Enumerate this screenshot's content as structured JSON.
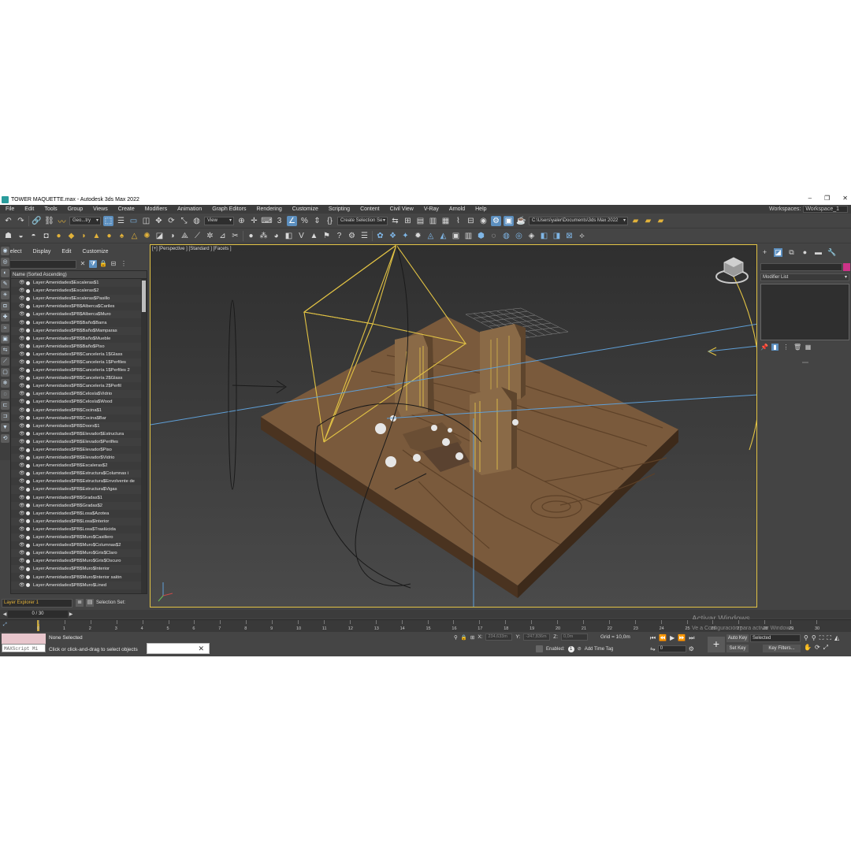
{
  "window": {
    "title": "TOWER MAQUETTE.max - Autodesk 3ds Max 2022",
    "controls": [
      "–",
      "❐",
      "✕"
    ]
  },
  "menu": {
    "items": [
      "File",
      "Edit",
      "Tools",
      "Group",
      "Views",
      "Create",
      "Modifiers",
      "Animation",
      "Graph Editors",
      "Rendering",
      "Customize",
      "Scripting",
      "Content",
      "Civil View",
      "V-Ray",
      "Arnold",
      "Help"
    ],
    "workspaces_label": "Workspaces:",
    "workspace_value": "Workspace_1"
  },
  "main_toolbar": {
    "geometry_filter": "Geo...try",
    "ref_coord": "View",
    "named_selection": "Create Selection Se",
    "project_path": "C:\\Users\\yaler\\Documents\\3ds Max 2022"
  },
  "scene_explorer": {
    "menu": [
      "Select",
      "Display",
      "Edit",
      "Customize"
    ],
    "column_header": "Name (Sorted Ascending)",
    "rows": [
      "Layer:Amenidades$Escaleras$1",
      "Layer:Amenidades$Escaleras$2",
      "Layer:Amenidades$Escaleras$Pasillo",
      "Layer:Amenidades$PB$Alberca$Cariles",
      "Layer:Amenidades$PB$Alberca$Muro",
      "Layer:Amenidades$PB$Baño$Barra",
      "Layer:Amenidades$PB$Baño$Mamparas",
      "Layer:Amenidades$PB$Baño$Mueble",
      "Layer:Amenidades$PB$Baño$Piso",
      "Layer:Amenidades$PB$Cancelería 1$Glass",
      "Layer:Amenidades$PB$Cancelería 1$Perfiles",
      "Layer:Amenidades$PB$Cancelería 1$Perfiles 2",
      "Layer:Amenidades$PB$Cancelería 2$Glass",
      "Layer:Amenidades$PB$Cancelería 2$Perfil",
      "Layer:Amenidades$PB$Celosía$Vidrio",
      "Layer:Amenidades$PB$Celosía$Wood",
      "Layer:Amenidades$PB$Cocina$1",
      "Layer:Amenidades$PB$Cocina$Bar",
      "Layer:Amenidades$PB$Doors$1",
      "Layer:Amenidades$PB$Elevador$Estructura",
      "Layer:Amenidades$PB$Elevador$Perilfes",
      "Layer:Amenidades$PB$Elevador$Piso",
      "Layer:Amenidades$PB$Elevador$Vidrio",
      "Layer:Amenidades$PB$Escaleras$2",
      "Layer:Amenidades$PB$Estructura$Columnas i",
      "Layer:Amenidades$PB$Estructura$Envolvente de",
      "Layer:Amenidades$PB$Estructura$Vigas",
      "Layer:Amenidades$PB$Gradas$1",
      "Layer:Amenidades$PB$Gradas$2",
      "Layer:Amenidades$PB$Losa$Azotea",
      "Layer:Amenidades$PB$Losa$Interior",
      "Layer:Amenidades$PB$Losa$Traslúcida",
      "Layer:Amenidades$PB$Muro$Casillero",
      "Layer:Amenidades$PB$Muro$Columnas$2",
      "Layer:Amenidades$PB$Muro$Gris$Claro",
      "Layer:Amenidades$PB$Muro$Gris$Oscuro",
      "Layer:Amenidades$PB$Muro$Interior",
      "Layer:Amenidades$PB$Muro$Interior salón",
      "Layer:Amenidades$PB$Muro$Lined"
    ],
    "bottom_explorer": "Layer Explorer 1",
    "selection_set_label": "Selection Set:"
  },
  "viewport": {
    "label": "[+] [Perspective ] [Standard ] [Facets ]"
  },
  "command_panel": {
    "modifier_list": "Modifier List",
    "object_color": "#cc3388"
  },
  "timeline": {
    "frame_display": "0 / 30",
    "ticks": [
      "0",
      "1",
      "2",
      "3",
      "4",
      "5",
      "6",
      "7",
      "8",
      "9",
      "10",
      "11",
      "12",
      "13",
      "14",
      "15",
      "16",
      "17",
      "18",
      "19",
      "20",
      "21",
      "22",
      "23",
      "24",
      "25",
      "26",
      "27",
      "28",
      "29",
      "30"
    ]
  },
  "status": {
    "maxscript": "MAXScript Mi",
    "selection": "None Selected",
    "prompt": "Click or click-and-drag to select objects",
    "x_label": "X:",
    "x_value": "234,633m",
    "y_label": "Y:",
    "y_value": "-247,836m",
    "z_label": "Z:",
    "z_value": "0,0m",
    "grid": "Grid = 10,0m",
    "enabled_label": "Enabled:",
    "add_time_tag": "Add Time Tag",
    "frame_field": "0",
    "auto_key": "Auto Key",
    "set_key": "Set Key",
    "key_mode": "Selected",
    "key_filters": "Key Filters...",
    "watermark_title": "Activar Windows",
    "watermark_sub": "Ve a Configuración para activar Windows."
  }
}
